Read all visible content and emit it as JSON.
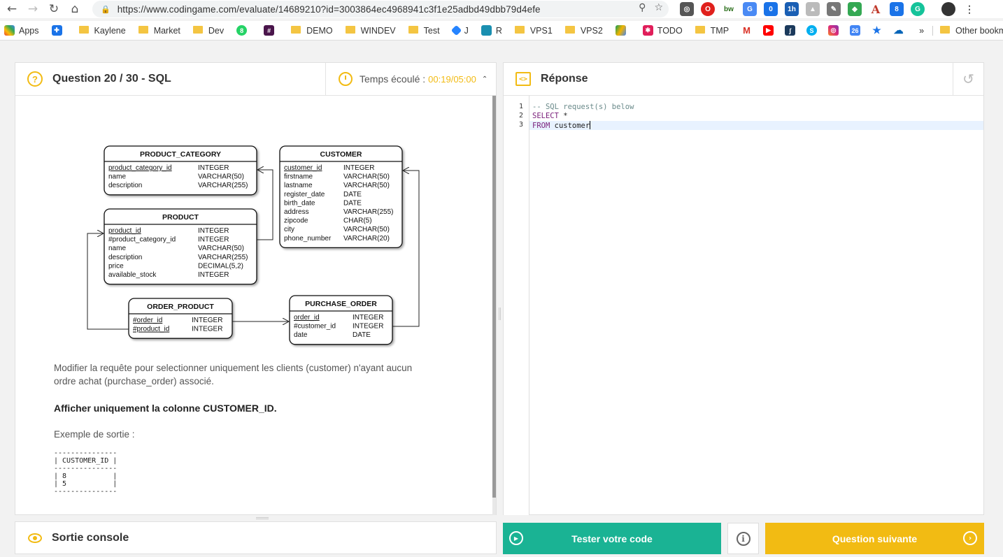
{
  "browser": {
    "url": "https://www.codingame.com/evaluate/14689210?id=3003864ec4968941c3f1e25adbd49dbb79d4efe",
    "bookmarks": [
      "Apps",
      "Kaylene",
      "Market",
      "Dev",
      "#",
      "DEMO",
      "WINDEV",
      "Test",
      "J",
      "R",
      "VPS1",
      "VPS2",
      "TODO",
      "TMP",
      "»",
      "Other bookmarks"
    ]
  },
  "question": {
    "title": "Question 20 / 30 - SQL",
    "timer_label": "Temps écoulé :",
    "timer_value": "00:19/05:00",
    "description_line1": "Modifier la requête pour selectionner uniquement les clients (customer) n'ayant aucun",
    "description_line2": "ordre achat (purchase_order) associé.",
    "instruction": "Afficher uniquement la colonne CUSTOMER_ID.",
    "example_label": "Exemple de sortie :",
    "example_output": "---------------\n| CUSTOMER_ID |\n---------------\n| 8           |\n| 5           |\n---------------"
  },
  "erd": {
    "tables": [
      {
        "name": "PRODUCT_CATEGORY",
        "columns": [
          [
            "product_category_id",
            "INTEGER",
            true
          ],
          [
            "name",
            "VARCHAR(50)",
            false
          ],
          [
            "description",
            "VARCHAR(255)",
            false
          ]
        ]
      },
      {
        "name": "CUSTOMER",
        "columns": [
          [
            "customer_id",
            "INTEGER",
            true
          ],
          [
            "firstname",
            "VARCHAR(50)",
            false
          ],
          [
            "lastname",
            "VARCHAR(50)",
            false
          ],
          [
            "register_date",
            "DATE",
            false
          ],
          [
            "birth_date",
            "DATE",
            false
          ],
          [
            "address",
            "VARCHAR(255)",
            false
          ],
          [
            "zipcode",
            "CHAR(5)",
            false
          ],
          [
            "city",
            "VARCHAR(50)",
            false
          ],
          [
            "phone_number",
            "VARCHAR(20)",
            false
          ]
        ]
      },
      {
        "name": "PRODUCT",
        "columns": [
          [
            "product_id",
            "INTEGER",
            true
          ],
          [
            "#product_category_id",
            "INTEGER",
            false
          ],
          [
            "name",
            "VARCHAR(50)",
            false
          ],
          [
            "description",
            "VARCHAR(255)",
            false
          ],
          [
            "price",
            "DECIMAL(5,2)",
            false
          ],
          [
            "available_stock",
            "INTEGER",
            false
          ]
        ]
      },
      {
        "name": "ORDER_PRODUCT",
        "columns": [
          [
            "#order_id",
            "INTEGER",
            true
          ],
          [
            "#product_id",
            "INTEGER",
            true
          ]
        ]
      },
      {
        "name": "PURCHASE_ORDER",
        "columns": [
          [
            "order_id",
            "INTEGER",
            true
          ],
          [
            "#customer_id",
            "INTEGER",
            false
          ],
          [
            "date",
            "DATE",
            false
          ]
        ]
      }
    ]
  },
  "answer": {
    "title": "Réponse",
    "code_lines": [
      [
        {
          "t": "-- SQL request(s) below",
          "c": "cm"
        }
      ],
      [
        {
          "t": "SELECT",
          "c": "kw"
        },
        {
          "t": " *",
          "c": "id"
        }
      ],
      [
        {
          "t": "FROM",
          "c": "kw"
        },
        {
          "t": " customer",
          "c": "id"
        }
      ]
    ],
    "active_line": 3
  },
  "console": {
    "title": "Sortie console"
  },
  "buttons": {
    "test": "Tester votre code",
    "next": "Question suivante"
  },
  "colors": {
    "accent": "#f2bb13",
    "green": "#1ab394"
  }
}
